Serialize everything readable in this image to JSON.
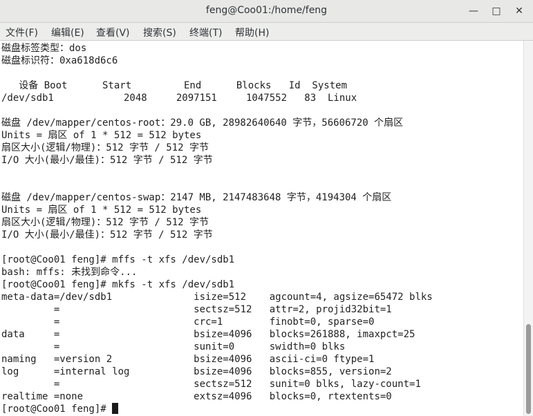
{
  "window": {
    "title": "feng@Coo01:/home/feng",
    "minimize_glyph": "—",
    "maximize_glyph": "□",
    "close_glyph": "✕"
  },
  "menu": [
    "文件(F)",
    "编辑(E)",
    "查看(V)",
    "搜索(S)",
    "终端(T)",
    "帮助(H)"
  ],
  "terminal": {
    "lines": [
      "磁盘标签类型：dos",
      "磁盘标识符：0xa618d6c6",
      "",
      "   设备 Boot      Start         End      Blocks   Id  System",
      "/dev/sdb1            2048     2097151     1047552   83  Linux",
      "",
      "磁盘 /dev/mapper/centos-root：29.0 GB, 28982640640 字节，56606720 个扇区",
      "Units = 扇区 of 1 * 512 = 512 bytes",
      "扇区大小(逻辑/物理)：512 字节 / 512 字节",
      "I/O 大小(最小/最佳)：512 字节 / 512 字节",
      "",
      "",
      "磁盘 /dev/mapper/centos-swap：2147 MB, 2147483648 字节，4194304 个扇区",
      "Units = 扇区 of 1 * 512 = 512 bytes",
      "扇区大小(逻辑/物理)：512 字节 / 512 字节",
      "I/O 大小(最小/最佳)：512 字节 / 512 字节",
      "",
      "[root@Coo01 feng]# mffs -t xfs /dev/sdb1",
      "bash: mffs: 未找到命令...",
      "[root@Coo01 feng]# mkfs -t xfs /dev/sdb1",
      "meta-data=/dev/sdb1              isize=512    agcount=4, agsize=65472 blks",
      "         =                       sectsz=512   attr=2, projid32bit=1",
      "         =                       crc=1        finobt=0, sparse=0",
      "data     =                       bsize=4096   blocks=261888, imaxpct=25",
      "         =                       sunit=0      swidth=0 blks",
      "naming   =version 2              bsize=4096   ascii-ci=0 ftype=1",
      "log      =internal log           bsize=4096   blocks=855, version=2",
      "         =                       sectsz=512   sunit=0 blks, lazy-count=1",
      "realtime =none                   extsz=4096   blocks=0, rtextents=0"
    ],
    "prompt": "[root@Coo01 feng]# "
  }
}
